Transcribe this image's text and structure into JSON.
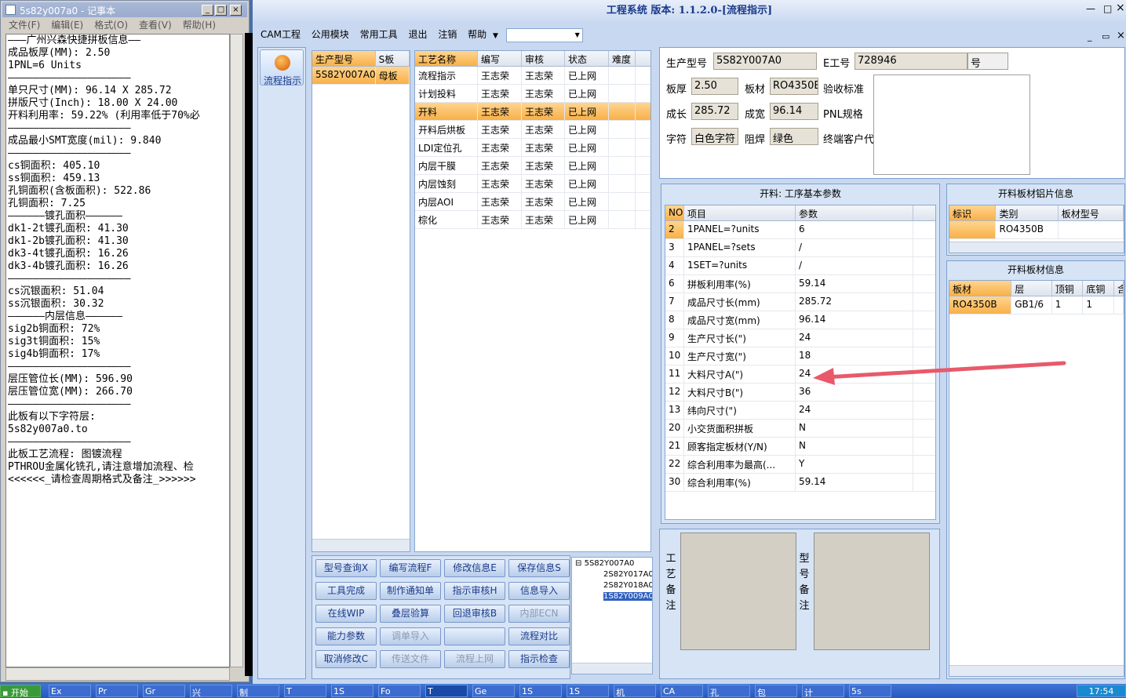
{
  "notepad": {
    "title": "5s82y007a0 - 记事本",
    "menu": [
      "文件(F)",
      "编辑(E)",
      "格式(O)",
      "查看(V)",
      "帮助(H)"
    ],
    "lines": [
      "———广州兴森快捷拼板信息——",
      "成品板厚(MM): 2.50",
      "1PNL=6 Units",
      "————————————————————",
      "单只尺寸(MM): 96.14 X 285.72",
      "拼版尺寸(Inch): 18.00 X 24.00",
      "开料利用率: 59.22% (利用率低于70%必",
      "————————————————————",
      "成品最小SMT宽度(mil): 9.840",
      "————————————————————",
      "cs铜面积: 405.10",
      "ss铜面积: 459.13",
      "孔铜面积(含板面积): 522.86",
      "孔铜面积: 7.25",
      "——————镀孔面积——————",
      "dk1-2t镀孔面积: 41.30",
      "dk1-2b镀孔面积: 41.30",
      "dk3-4t镀孔面积: 16.26",
      "dk3-4b镀孔面积: 16.26",
      "",
      "————————————————————",
      "cs沉银面积: 51.04",
      "ss沉银面积: 30.32",
      "——————内层信息——————",
      "sig2b铜面积: 72%",
      "sig3t铜面积: 15%",
      "sig4b铜面积: 17%",
      "————————————————————",
      "层压管位长(MM): 596.90",
      "层压管位宽(MM): 266.70",
      "————————————————————",
      "此板有以下字符层:",
      "5s82y007a0.to",
      "————————————————————",
      "此板工艺流程: 图镀流程",
      "PTHROU金属化铣孔,请注意增加流程、检",
      "<<<<<<_请检查周期格式及备注_>>>>>>"
    ]
  },
  "app": {
    "title": "工程系统  版本: 1.1.2.0-[流程指示]",
    "menu": [
      "CAM工程",
      "公用模块",
      "常用工具",
      "退出",
      "注销",
      "帮助"
    ],
    "flow_button": "流程指示",
    "model_grid": {
      "headers": [
        "生产型号",
        "S板"
      ],
      "rows": [
        [
          "5S82Y007A0",
          "母板"
        ]
      ]
    },
    "process_grid": {
      "headers": [
        "工艺名称",
        "编写",
        "审核",
        "状态",
        "难度"
      ],
      "rows": [
        [
          "流程指示",
          "王志荣",
          "王志荣",
          "已上网",
          ""
        ],
        [
          "计划投料",
          "王志荣",
          "王志荣",
          "已上网",
          ""
        ],
        [
          "开料",
          "王志荣",
          "王志荣",
          "已上网",
          ""
        ],
        [
          "开料后烘板",
          "王志荣",
          "王志荣",
          "已上网",
          ""
        ],
        [
          "LDI定位孔",
          "王志荣",
          "王志荣",
          "已上网",
          ""
        ],
        [
          "内层干膜",
          "王志荣",
          "王志荣",
          "已上网",
          ""
        ],
        [
          "内层蚀刻",
          "王志荣",
          "王志荣",
          "已上网",
          ""
        ],
        [
          "内层AOI",
          "王志荣",
          "王志荣",
          "已上网",
          ""
        ],
        [
          "棕化",
          "王志荣",
          "王志荣",
          "已上网",
          ""
        ]
      ]
    },
    "info": {
      "prod_label": "生产型号",
      "prod_value": "5S82Y007A0",
      "e_label": "E工号",
      "e_value": "728946",
      "e_suffix": "号",
      "thick_label": "板厚",
      "thick_value": "2.50",
      "mat_label": "板材",
      "mat_value": "RO4350E",
      "accept_label": "验收标准",
      "len_label": "成长",
      "len_value": "285.72",
      "wid_label": "成宽",
      "wid_value": "96.14",
      "pnl_label": "PNL规格",
      "char_label": "字符",
      "char_value": "白色字符",
      "mask_label": "阻焊",
      "mask_value": "绿色",
      "cust_label": "终端客户代"
    },
    "params": {
      "title": "开料: 工序基本参数",
      "headers": [
        "NO",
        "项目",
        "参数"
      ],
      "rows": [
        [
          "2",
          "1PANEL=?units",
          "6"
        ],
        [
          "3",
          "1PANEL=?sets",
          "/"
        ],
        [
          "4",
          "1SET=?units",
          "/"
        ],
        [
          "6",
          "拼板利用率(%)",
          "59.14"
        ],
        [
          "7",
          "成品尺寸长(mm)",
          "285.72"
        ],
        [
          "8",
          "成品尺寸宽(mm)",
          "96.14"
        ],
        [
          "9",
          "生产尺寸长(\")",
          "24"
        ],
        [
          "10",
          "生产尺寸宽(\")",
          "18"
        ],
        [
          "11",
          "大料尺寸A(\")",
          "24"
        ],
        [
          "12",
          "大料尺寸B(\")",
          "36"
        ],
        [
          "13",
          "纬向尺寸(\")",
          "24"
        ],
        [
          "20",
          "小交货面积拼板",
          "N"
        ],
        [
          "21",
          "顾客指定板材(Y/N)",
          "N"
        ],
        [
          "22",
          "综合利用率为最高(...",
          "Y"
        ],
        [
          "30",
          "综合利用率(%)",
          "59.14"
        ]
      ]
    },
    "sheet_pic": {
      "title": "开料板材铝片信息",
      "headers": [
        "标识",
        "类别",
        "板材型号"
      ],
      "rows": [
        [
          "",
          "RO4350B",
          ""
        ]
      ]
    },
    "sheet_info": {
      "title": "开料板材信息",
      "headers": [
        "板材",
        "层",
        "顶铜",
        "底铜",
        "含"
      ],
      "rows": [
        [
          "RO4350B",
          "GB1/6",
          "1",
          "1",
          ""
        ]
      ]
    },
    "buttons": [
      [
        "型号查询X",
        "编写流程F",
        "修改信息E",
        "保存信息S"
      ],
      [
        "工具完成",
        "制作通知单",
        "指示审核H",
        "信息导入"
      ],
      [
        "在线WIP",
        "叠层验算",
        "回退审核B",
        "内部ECN"
      ],
      [
        "能力参数",
        "调单导入",
        "",
        "流程对比"
      ],
      [
        "取消修改C",
        "传送文件",
        "流程上网",
        "指示检查"
      ]
    ],
    "disabled": [
      "内部ECN",
      "调单导入",
      "传送文件",
      "流程上网"
    ],
    "tree": {
      "root": "5S82Y007A0",
      "children": [
        "2S82Y017A0",
        "2S82Y018A0",
        "1S82Y009A0"
      ]
    },
    "remark_process": "工艺备注",
    "remark_model": "型号备注"
  },
  "taskbar": {
    "start": "开始",
    "items": [
      "Ex",
      "Pr",
      "Gr",
      "兴",
      "制",
      "T",
      "1S",
      "Fo",
      "T",
      "Ge",
      "1S",
      "1S",
      "机",
      "CA",
      "孔",
      "包",
      "计",
      "5s"
    ],
    "clock": "17:54"
  },
  "colors": {
    "accent": "#f8b048",
    "arrow": "#e85a6a"
  }
}
